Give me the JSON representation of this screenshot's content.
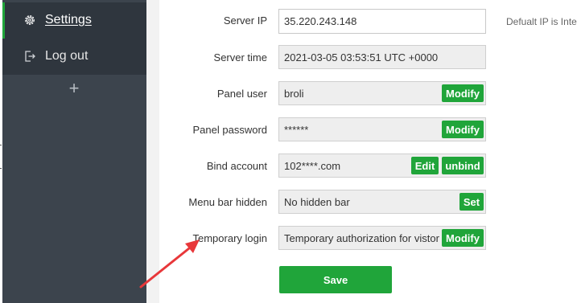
{
  "sidebar": {
    "items": [
      {
        "label": "Settings",
        "icon": "gear-icon",
        "active": true
      },
      {
        "label": "Log out",
        "icon": "logout-icon",
        "active": false
      }
    ],
    "add_label": "+"
  },
  "settings": {
    "server_ip": {
      "label": "Server IP",
      "value": "35.220.243.148",
      "hint": "Defualt IP is Inte"
    },
    "server_time": {
      "label": "Server time",
      "value": "2021-03-05 03:53:51 UTC +0000"
    },
    "panel_user": {
      "label": "Panel user",
      "value": "broli",
      "modify_label": "Modify"
    },
    "panel_password": {
      "label": "Panel password",
      "value": "******",
      "modify_label": "Modify"
    },
    "bind_account": {
      "label": "Bind account",
      "value": "102****.com",
      "edit_label": "Edit",
      "unbind_label": "unbind"
    },
    "menu_bar_hidden": {
      "label": "Menu bar hidden",
      "value": "No hidden bar",
      "set_label": "Set"
    },
    "temporary_login": {
      "label": "Temporary login",
      "value": "Temporary authorization for vistor",
      "modify_label": "Modify"
    }
  },
  "save_label": "Save",
  "colors": {
    "accent_green": "#20a53a",
    "sidebar_bg": "#3c444d",
    "sidebar_item_bg": "#2f363e",
    "annotation_arrow": "#e8373a"
  }
}
